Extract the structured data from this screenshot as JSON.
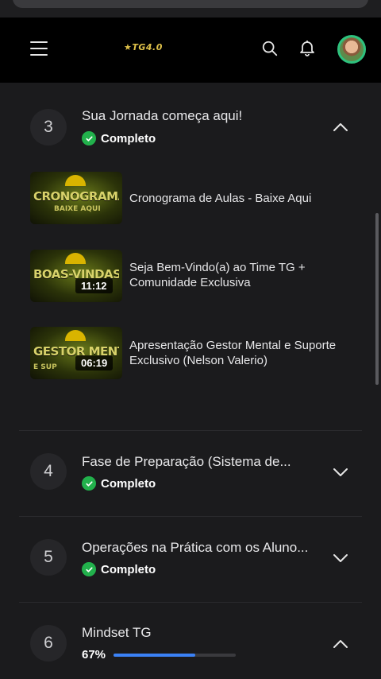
{
  "header": {
    "logo_text": "★TG4.0",
    "menu_icon": "hamburger-menu-icon",
    "search_icon": "search-icon",
    "notification_icon": "bell-icon"
  },
  "modules": [
    {
      "number": "3",
      "title": "Sua Jornada começa aqui!",
      "status": "Completo",
      "expanded": true,
      "lessons": [
        {
          "title": "Cronograma de Aulas - Baixe Aqui",
          "thumb_text": "CRONOGRAMA",
          "thumb_sub": "BAIXE AQUI",
          "duration": ""
        },
        {
          "title": "Seja Bem-Vindo(a) ao Time TG + Comunidade Exclusiva",
          "thumb_text": "BOAS-VINDAS!",
          "thumb_sub": "",
          "duration": "11:12"
        },
        {
          "title": "Apresentação Gestor Mental e Suporte Exclusivo (Nelson Valerio)",
          "thumb_text": "GESTOR MENTAL",
          "thumb_sub": "E SUP",
          "duration": "06:19"
        }
      ]
    },
    {
      "number": "4",
      "title": "Fase de Preparação (Sistema de...",
      "status": "Completo",
      "expanded": false
    },
    {
      "number": "5",
      "title": "Operações na Prática com os Aluno...",
      "status": "Completo",
      "expanded": false
    },
    {
      "number": "6",
      "title": "Mindset TG",
      "progress_label": "67%",
      "progress": 0.67,
      "expanded": true
    }
  ],
  "colors": {
    "accent": "#3b82f6",
    "complete": "#22b14c",
    "logo": "#e0c24a"
  }
}
